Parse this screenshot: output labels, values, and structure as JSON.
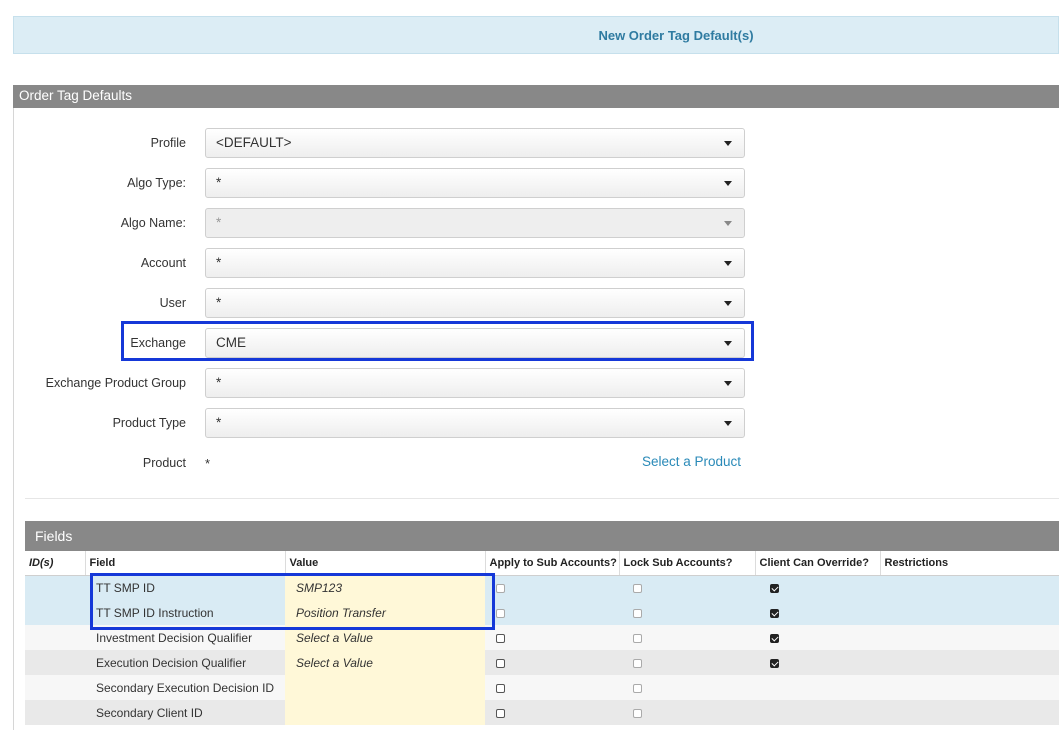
{
  "banner": {
    "title": "New Order Tag Default(s)"
  },
  "section": {
    "title": "Order Tag Defaults"
  },
  "form": {
    "profile": {
      "label": "Profile",
      "value": "<DEFAULT>"
    },
    "algo_type": {
      "label": "Algo Type:",
      "value": "*"
    },
    "algo_name": {
      "label": "Algo Name:",
      "value": "*"
    },
    "account": {
      "label": "Account",
      "value": "*"
    },
    "user": {
      "label": "User",
      "value": "*"
    },
    "exchange": {
      "label": "Exchange",
      "value": "CME"
    },
    "exchange_product_group": {
      "label": "Exchange Product Group",
      "value": "*"
    },
    "product_type": {
      "label": "Product Type",
      "value": "*"
    },
    "product": {
      "label": "Product",
      "value": "*",
      "link": "Select a Product"
    }
  },
  "fields": {
    "title": "Fields",
    "columns": {
      "ids": "ID(s)",
      "field": "Field",
      "value": "Value",
      "apply_sub": "Apply to Sub Accounts?",
      "lock_sub": "Lock Sub Accounts?",
      "client_override": "Client Can Override?",
      "restrictions": "Restrictions"
    },
    "rows": [
      {
        "field": "TT SMP ID",
        "value": "SMP123",
        "apply_sub": false,
        "lock_sub": false,
        "client_override": true
      },
      {
        "field": "TT SMP ID Instruction",
        "value": "Position Transfer",
        "apply_sub": false,
        "lock_sub": false,
        "client_override": true
      },
      {
        "field": "Investment Decision Qualifier",
        "value": "Select a Value",
        "apply_sub": false,
        "lock_sub": false,
        "client_override": true
      },
      {
        "field": "Execution Decision Qualifier",
        "value": "Select a Value",
        "apply_sub": false,
        "lock_sub": false,
        "client_override": true
      },
      {
        "field": "Secondary Execution Decision ID",
        "value": "",
        "apply_sub": false,
        "lock_sub": false,
        "client_override": null
      },
      {
        "field": "Secondary Client ID",
        "value": "",
        "apply_sub": false,
        "lock_sub": false,
        "client_override": null
      }
    ]
  },
  "colors": {
    "banner_bg": "#dcedf5",
    "banner_text": "#2f7ba1",
    "header_bg": "#888888",
    "highlight": "#1538d8",
    "link": "#2a8ab8",
    "value_cell": "#fff8d8"
  }
}
